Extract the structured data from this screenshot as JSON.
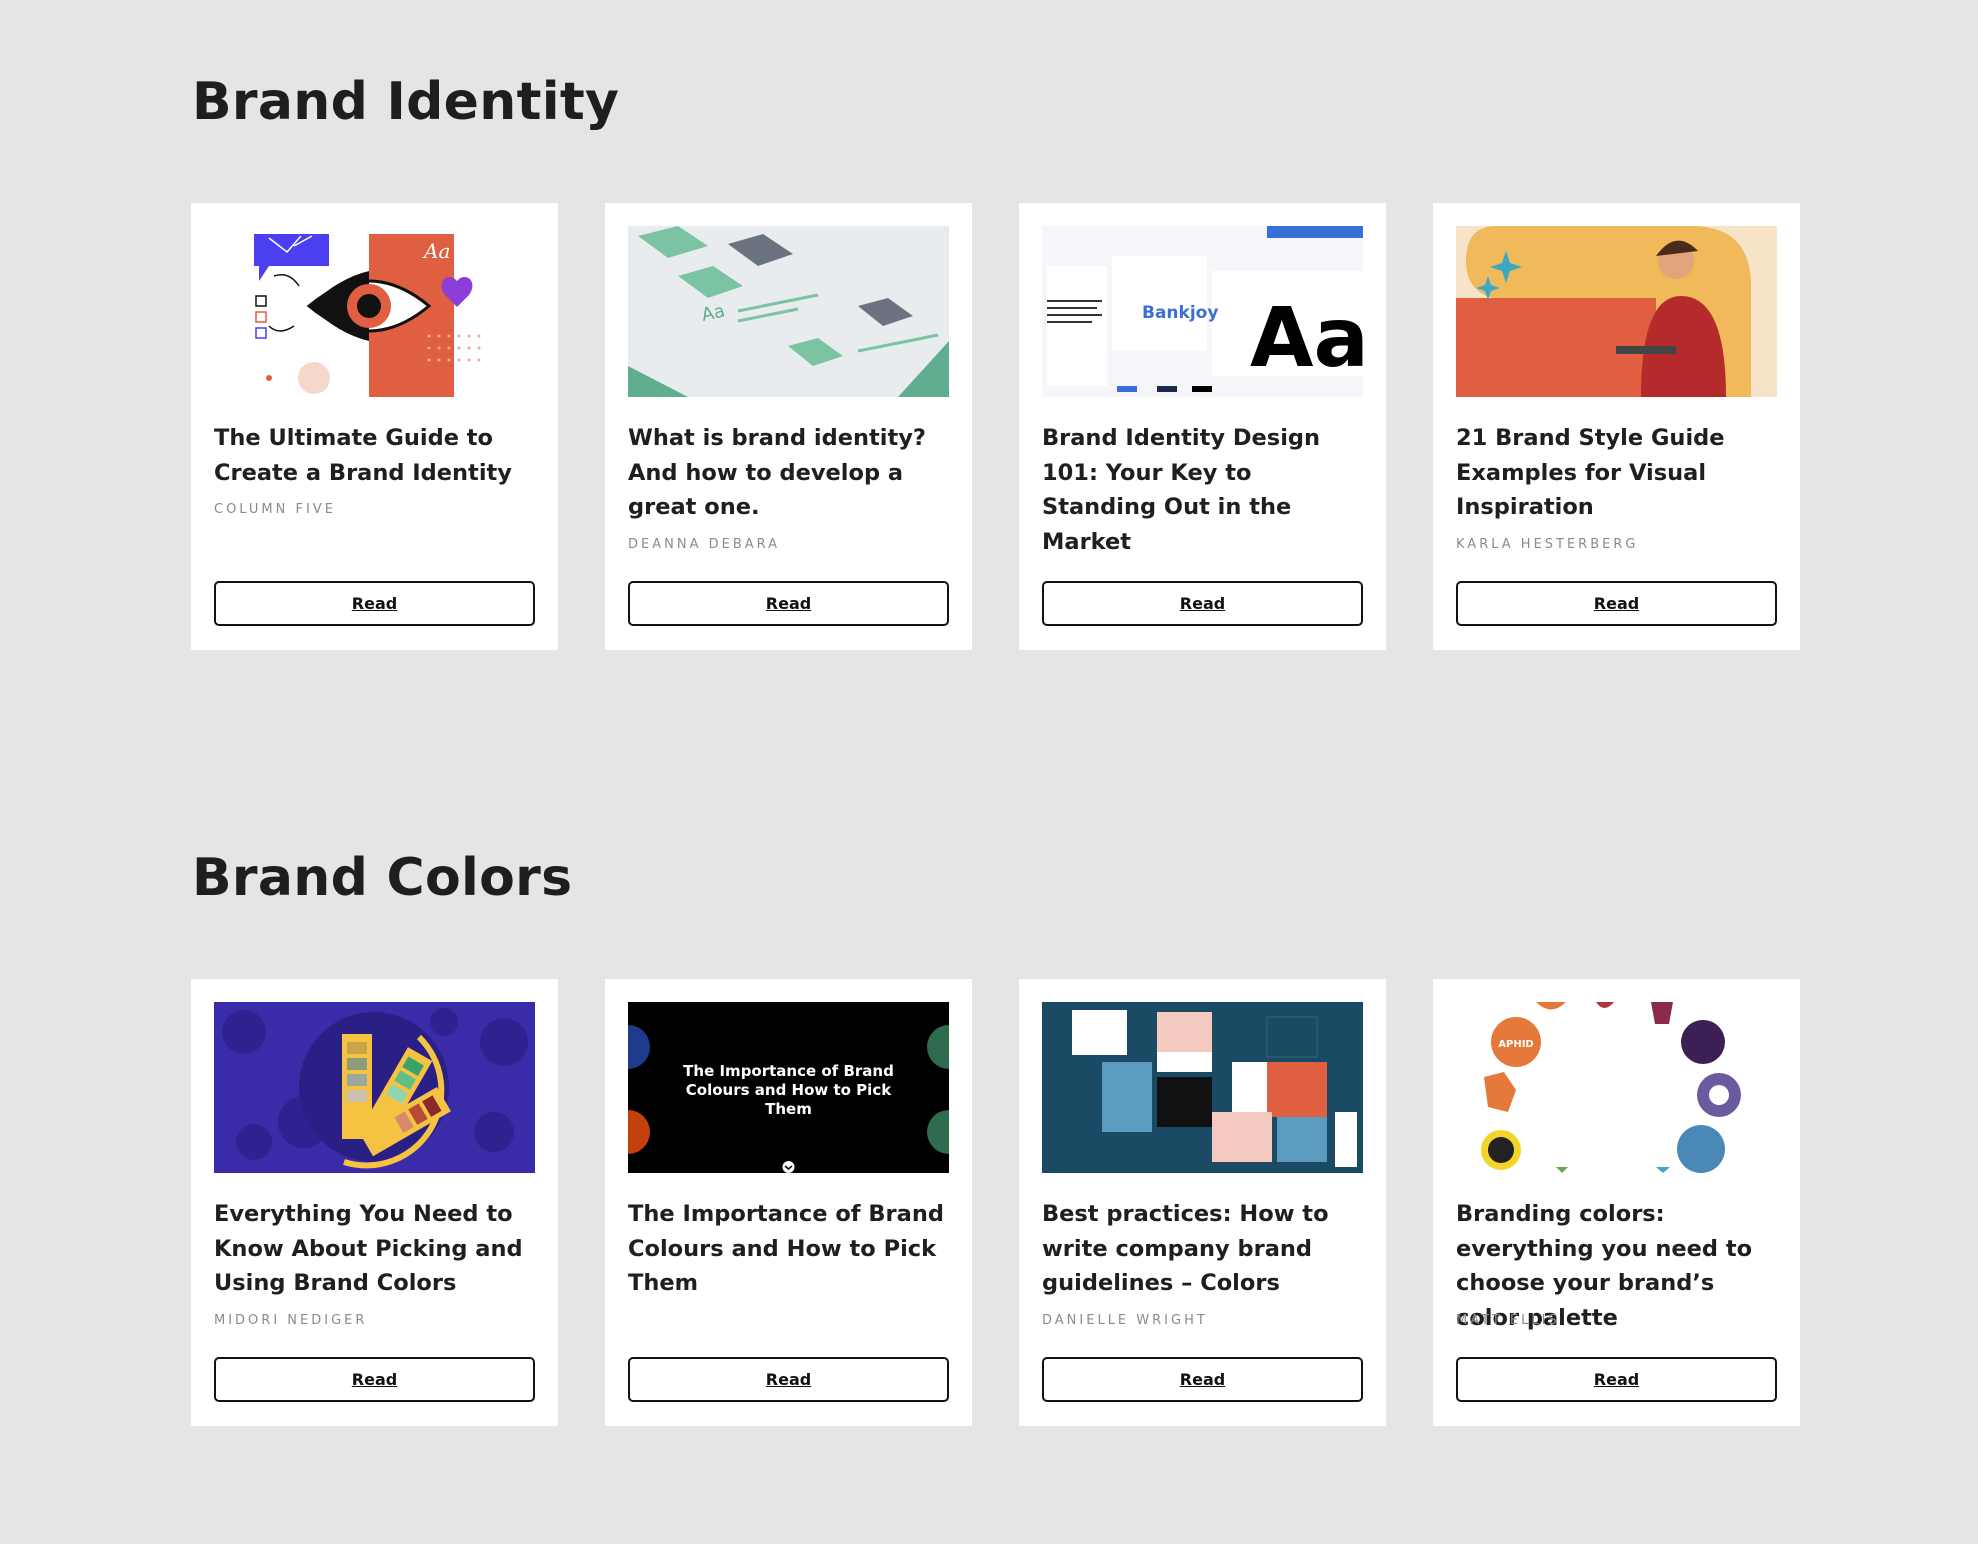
{
  "sections": [
    {
      "title": "Brand Identity",
      "cards": [
        {
          "title": "The Ultimate Guide to Create a Brand Identity",
          "author": "COLUMN FIVE",
          "thumb_label": "Aa",
          "button": "Read"
        },
        {
          "title": "What is brand identity? And how to develop a great one.",
          "author": "DEANNA DEBARA",
          "thumb_label": "Aa",
          "button": "Read"
        },
        {
          "title": "Brand Identity Design 101: Your Key to Standing Out in the Market",
          "author": "",
          "thumb_label": "Bankjoy",
          "thumb_label2": "Aa",
          "button": "Read"
        },
        {
          "title": "21 Brand Style Guide Examples for Visual Inspiration",
          "author": "KARLA HESTERBERG",
          "button": "Read"
        }
      ]
    },
    {
      "title": "Brand Colors",
      "cards": [
        {
          "title": "Everything You Need to Know About Picking and Using Brand Colors",
          "author": "MIDORI NEDIGER",
          "button": "Read"
        },
        {
          "title": "The Importance of Brand Colours and How to Pick Them",
          "author": "",
          "thumb_label": [
            "The Importance of Brand",
            "Colours and How to Pick",
            "Them"
          ],
          "button": "Read"
        },
        {
          "title": "Best practices: How to write company brand guidelines – Colors",
          "author": "DANIELLE WRIGHT",
          "button": "Read"
        },
        {
          "title": "Branding colors: everything you need to choose your brand’s color palette",
          "author": "MATT ELLIS",
          "thumb_label": "APHID",
          "button": "Read"
        }
      ]
    }
  ],
  "colors": {
    "page_bg": "#e5e5e5",
    "card_bg": "#ffffff",
    "title_text": "#1f1f1f",
    "author_text": "#8b8b8b",
    "accent_orange": "#e15f41",
    "accent_blue": "#4b3ff0",
    "accent_green": "#5fae8f",
    "accent_navy": "#1b4b64",
    "accent_purple": "#3a2ca8",
    "accent_yellow": "#f0b95a"
  }
}
